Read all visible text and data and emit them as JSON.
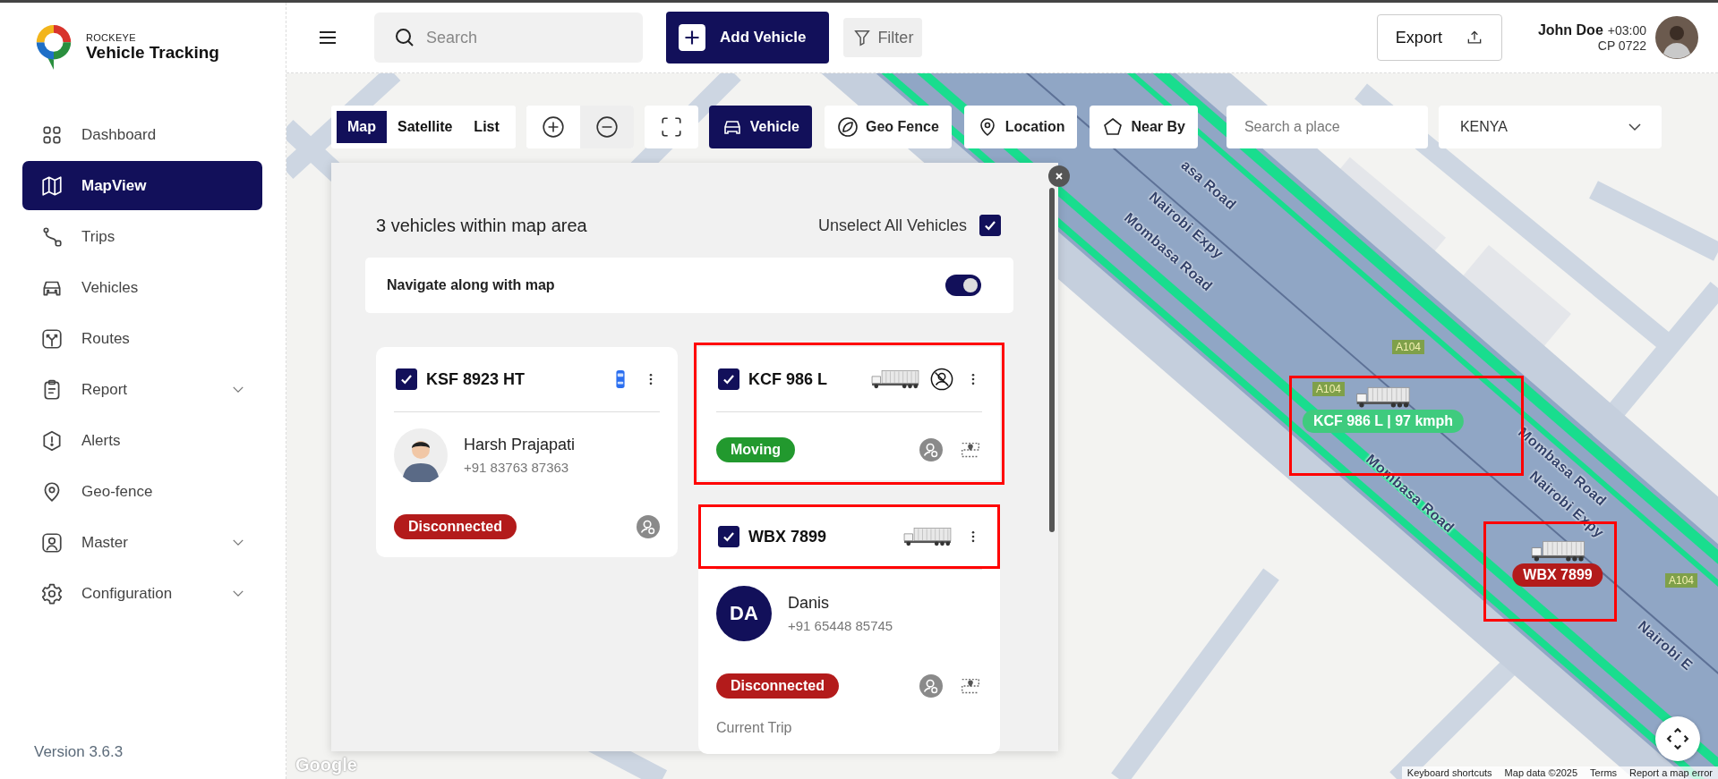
{
  "sidebar": {
    "brand": {
      "company": "ROCKEYE",
      "product": "Vehicle Tracking"
    },
    "items": [
      {
        "label": "Dashboard",
        "selected": false,
        "expandable": false
      },
      {
        "label": "MapView",
        "selected": true,
        "expandable": false
      },
      {
        "label": "Trips",
        "selected": false,
        "expandable": false
      },
      {
        "label": "Vehicles",
        "selected": false,
        "expandable": false
      },
      {
        "label": "Routes",
        "selected": false,
        "expandable": false
      },
      {
        "label": "Report",
        "selected": false,
        "expandable": true
      },
      {
        "label": "Alerts",
        "selected": false,
        "expandable": false
      },
      {
        "label": "Geo-fence",
        "selected": false,
        "expandable": false
      },
      {
        "label": "Master",
        "selected": false,
        "expandable": true
      },
      {
        "label": "Configuration",
        "selected": false,
        "expandable": true
      }
    ],
    "version": "Version 3.6.3"
  },
  "topbar": {
    "search": {
      "placeholder": "Search"
    },
    "add_button": "Add Vehicle",
    "filter_button": "Filter",
    "export_button": "Export",
    "user": {
      "name": "John Doe",
      "timezone": "+03:00",
      "code": "CP 0722"
    }
  },
  "map": {
    "view_modes": [
      {
        "label": "Map",
        "selected": true
      },
      {
        "label": "Satellite",
        "selected": false
      },
      {
        "label": "List",
        "selected": false
      }
    ],
    "layers": [
      {
        "label": "Vehicle",
        "selected": true
      },
      {
        "label": "Geo Fence",
        "selected": false
      },
      {
        "label": "Location",
        "selected": false
      },
      {
        "label": "Near By",
        "selected": false
      }
    ],
    "place_search": {
      "placeholder": "Search a place"
    },
    "country": {
      "value": "KENYA"
    },
    "road_labels": [
      "asa Road",
      "Nairobi Expy",
      "Mombasa Road",
      "Mombasa Road",
      "Nairobi Expy",
      "Mombasa Road",
      "Nairobi E"
    ],
    "route_shields": [
      "A104",
      "A104",
      "A104"
    ],
    "markers": [
      {
        "label": "KCF 986 L | 97 kmph",
        "color": "#3fcb7e",
        "highlighted": true
      },
      {
        "label": "WBX 7899",
        "color": "#b31b1b",
        "highlighted": true
      }
    ],
    "google_logo": "Google",
    "footer": [
      "Keyboard shortcuts",
      "Map data ©2025",
      "Terms",
      "Report a map error"
    ]
  },
  "panel": {
    "title": "3 vehicles within map area",
    "unselect_all": {
      "label": "Unselect All Vehicles",
      "checked": true
    },
    "navigate": {
      "label": "Navigate along with map",
      "on": true
    },
    "vehicles": [
      {
        "plate": "KSF 8923 HT",
        "checked": true,
        "kind": "car",
        "highlighted": false,
        "driver": {
          "name": "Harsh Prajapati",
          "phone": "+91 83763 87363"
        },
        "status": {
          "label": "Disconnected",
          "color": "#b31b1b"
        },
        "actions": [
          {
            "kind": "driver"
          }
        ]
      },
      {
        "plate": "KCF 986 L",
        "checked": true,
        "kind": "truck",
        "highlighted": true,
        "status": {
          "label": "Moving",
          "color": "#22992e"
        },
        "actions": [
          {
            "kind": "driver"
          },
          {
            "kind": "route"
          }
        ]
      },
      {
        "plate": "WBX 7899",
        "checked": true,
        "kind": "truck",
        "highlighted": true,
        "driver": {
          "name": "Danis",
          "initials": "DA",
          "phone": "+91 65448 85745"
        },
        "status": {
          "label": "Disconnected",
          "color": "#b31b1b"
        },
        "actions": [
          {
            "kind": "driver"
          },
          {
            "kind": "route"
          }
        ],
        "section": "Current Trip"
      }
    ]
  }
}
